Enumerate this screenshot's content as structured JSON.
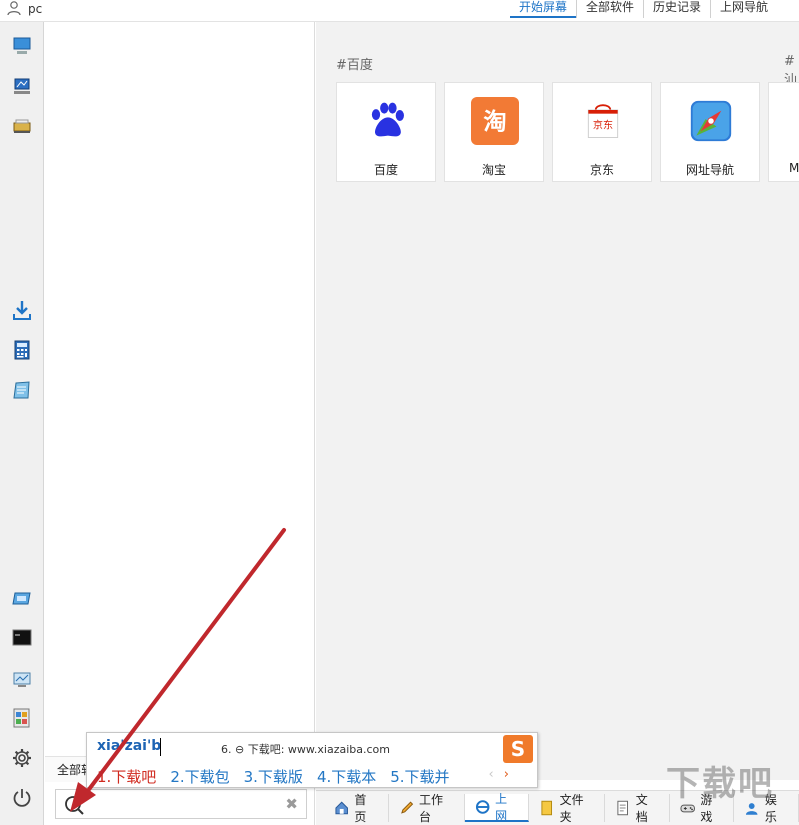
{
  "user": {
    "name": "pc",
    "icon": "user-icon"
  },
  "top_tabs": [
    {
      "label": "开始屏幕",
      "active": true
    },
    {
      "label": "全部软件",
      "active": false
    },
    {
      "label": "历史记录",
      "active": false
    },
    {
      "label": "上网导航",
      "active": false
    }
  ],
  "left_icons": [
    "computer-icon",
    "network-computer-icon",
    "scanner-icon",
    "download-icon",
    "calculator-icon",
    "notepad-icon",
    "display-icon",
    "terminal-icon",
    "monitor-icon",
    "control-panel-icon",
    "gear-icon",
    "power-icon"
  ],
  "start_screen": {
    "group_title": "#百度",
    "group_title_2": "#汕",
    "tiles": [
      {
        "label": "百度",
        "icon": "baidu-paw-icon",
        "color": "#2932e1"
      },
      {
        "label": "淘宝",
        "icon": "taobao-icon",
        "color": "#f27a35"
      },
      {
        "label": "京东",
        "icon": "jd-bag-icon",
        "color": "#d81e06"
      },
      {
        "label": "网址导航",
        "icon": "compass-icon",
        "color": "#2e7bd6"
      },
      {
        "label": "M",
        "icon": "partial-tile-icon",
        "color": "#999999"
      }
    ]
  },
  "mid_panel": {
    "footer_label": "全部软"
  },
  "search": {
    "value": "",
    "placeholder": "",
    "clear_glyph": "✖"
  },
  "bottom_tabs": [
    {
      "label": "首页",
      "icon": "home-icon",
      "active": false
    },
    {
      "label": "工作台",
      "icon": "pencil-icon",
      "active": false
    },
    {
      "label": "上网",
      "icon": "ie-icon",
      "active": true
    },
    {
      "label": "文件夹",
      "icon": "folder-icon",
      "active": false
    },
    {
      "label": "文档",
      "icon": "document-icon",
      "active": false
    },
    {
      "label": "游戏",
      "icon": "gamepad-icon",
      "active": false
    },
    {
      "label": "娱乐",
      "icon": "entertainment-icon",
      "active": false
    }
  ],
  "ime": {
    "pinyin": "xia'zai'b",
    "extra": "6. ⊖ 下载吧: www.xiazaiba.com",
    "logo": "S",
    "candidates": [
      "1.下载吧",
      "2.下载包",
      "3.下载版",
      "4.下载本",
      "5.下载并"
    ],
    "prev": "‹",
    "next": "›"
  },
  "watermark": "下载吧",
  "colors": {
    "accent": "#1e74c7",
    "arrow": "#c0282d",
    "ime_highlight": "#d02a1f"
  }
}
